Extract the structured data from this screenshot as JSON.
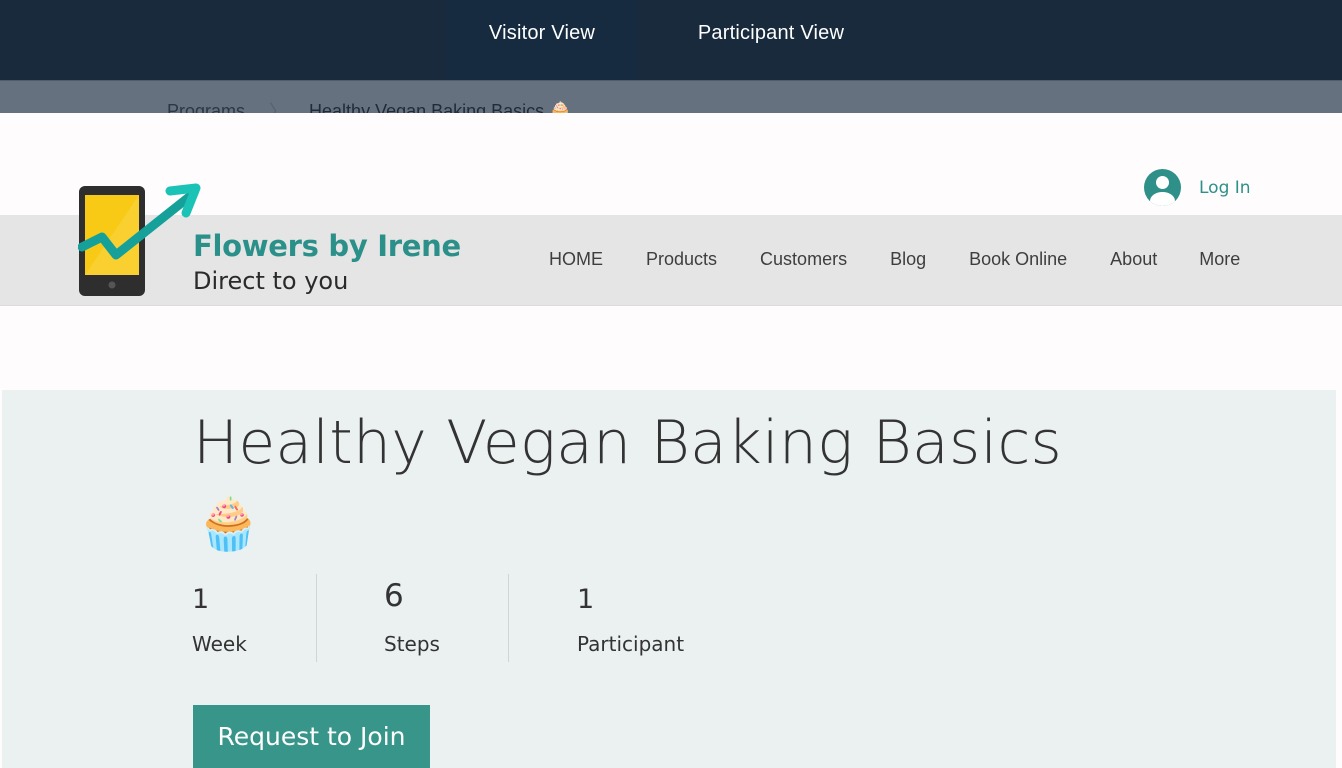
{
  "view_switcher": {
    "tabs": [
      {
        "label": "Visitor View",
        "active": true
      },
      {
        "label": "Participant View",
        "active": false
      }
    ]
  },
  "breadcrumb": {
    "items": [
      "Programs",
      "Healthy Vegan Baking Basics 🧁"
    ],
    "separator": "〉"
  },
  "site": {
    "brand_name": "Flowers by Irene",
    "tagline": "Direct to you",
    "login_label": "Log In",
    "menu": [
      "HOME",
      "Products",
      "Customers",
      "Blog",
      "Book Online",
      "About",
      "More"
    ],
    "colors": {
      "brand": "#2a9089",
      "top_bar": "#182a3c",
      "nav_band": "#e5e5e5"
    }
  },
  "program": {
    "title": "Healthy Vegan Baking Basics",
    "emoji": "🧁",
    "stats": [
      {
        "value": "1",
        "label": "Week"
      },
      {
        "value": "6",
        "label": "Steps"
      },
      {
        "value": "1",
        "label": "Participant"
      }
    ],
    "cta_label": "Request to Join",
    "colors": {
      "section_bg": "#ebf1f1",
      "cta": "#37958a"
    }
  }
}
